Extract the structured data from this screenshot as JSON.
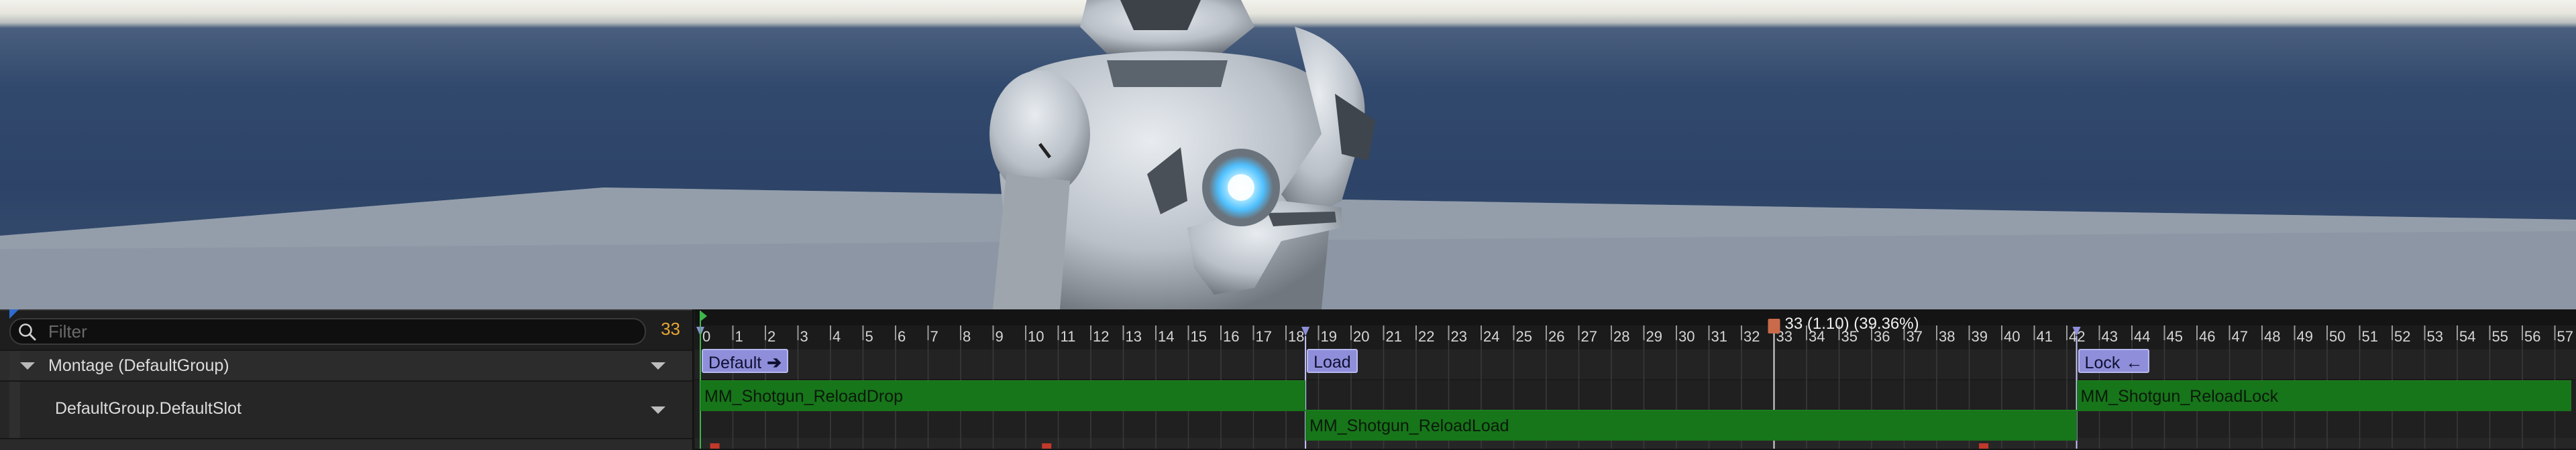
{
  "viewport": {
    "sky_color": "#2d4468",
    "floor_color": "#8f98a6",
    "character": "robot-mannequin"
  },
  "tracks": {
    "filter_placeholder": "Filter",
    "frame_count": "33",
    "montage_label": "Montage (DefaultGroup)",
    "slot_label": "DefaultGroup.DefaultSlot"
  },
  "timeline": {
    "frames": [
      "0",
      "1",
      "2",
      "3",
      "4",
      "5",
      "6",
      "7",
      "8",
      "9",
      "10",
      "11",
      "12",
      "13",
      "14",
      "15",
      "16",
      "17",
      "18",
      "19",
      "20",
      "21",
      "22",
      "23",
      "24",
      "25",
      "26",
      "27",
      "28",
      "29",
      "30",
      "31",
      "32",
      "33",
      "34",
      "35",
      "36",
      "37",
      "38",
      "39",
      "40",
      "41",
      "42",
      "43",
      "44",
      "45",
      "46",
      "47",
      "48",
      "49",
      "50",
      "51",
      "52",
      "53",
      "54",
      "55",
      "56",
      "57"
    ],
    "playhead": {
      "frame": 33,
      "label": "33 (1.10) (39.36%)"
    },
    "sections": [
      {
        "name": "Default",
        "frame": 0,
        "arrow": "🡒"
      },
      {
        "name": "Load",
        "frame": 18.6,
        "arrow": ""
      },
      {
        "name": "Lock",
        "frame": 42.3,
        "arrow": "🡐"
      }
    ],
    "clips": [
      {
        "name": "MM_Shotgun_ReloadDrop",
        "start": 0,
        "end": 18.6,
        "lane": 0
      },
      {
        "name": "MM_Shotgun_ReloadLoad",
        "start": 18.6,
        "end": 42.3,
        "lane": 1
      },
      {
        "name": "MM_Shotgun_ReloadLock",
        "start": 42.3,
        "end": 57.5,
        "lane": 0
      }
    ],
    "colors": {
      "clip": "#17751a",
      "section": "#8e8eda",
      "playhead": "#c96a4a",
      "frame_label_color": "#d6d6d6"
    }
  }
}
